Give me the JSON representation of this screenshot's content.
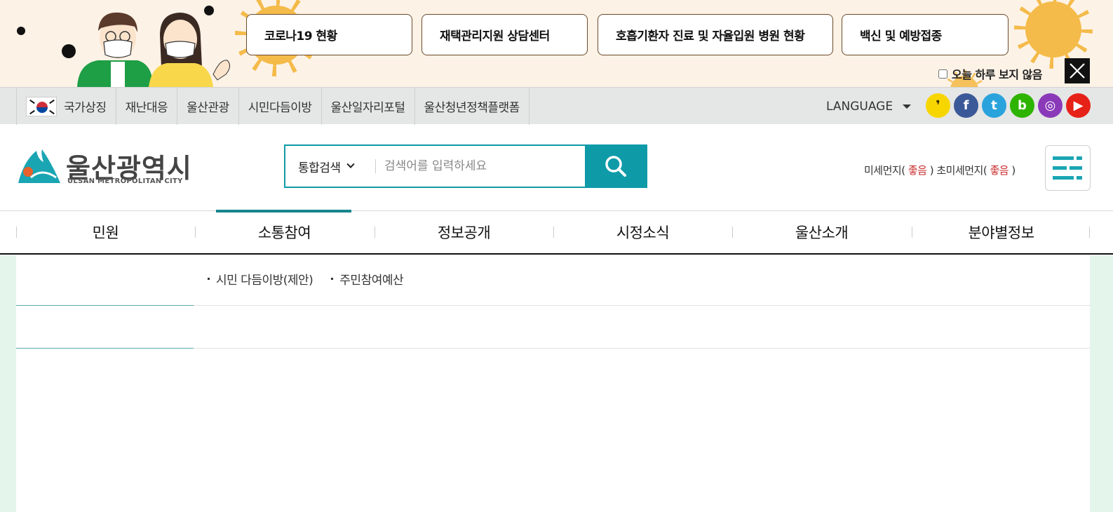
{
  "banner": {
    "buttons": [
      "코로나19 현황",
      "재택관리지원 상담센터",
      "호흡기환자 진료 및 자율입원 병원 현황",
      "백신 및 예방접종"
    ],
    "no_more_today": "오늘 하루 보지 않음",
    "close_icon": "close-icon"
  },
  "utilbar": {
    "links": [
      "국가상징",
      "재난대응",
      "울산관광",
      "시민다듬이방",
      "울산일자리포털",
      "울산청년정책플랫폼"
    ],
    "language": "LANGUAGE",
    "sns": [
      {
        "name": "kakaostory-icon",
        "glyph": "❜",
        "color": "#f7d600"
      },
      {
        "name": "facebook-icon",
        "glyph": "f",
        "color": "#3b5998"
      },
      {
        "name": "twitter-icon",
        "glyph": "t",
        "color": "#2aa3dc"
      },
      {
        "name": "blog-icon",
        "glyph": "b",
        "color": "#2db400"
      },
      {
        "name": "instagram-icon",
        "glyph": "◎",
        "color": "#8a3ab9"
      },
      {
        "name": "youtube-icon",
        "glyph": "▶",
        "color": "#e62117"
      }
    ]
  },
  "header": {
    "logo_text": "울산광역시",
    "logo_sub": "ULSAN METROPOLITAN CITY",
    "search_scope": "통합검색",
    "search_placeholder": "검색어를 입력하세요",
    "dust_label1": "미세먼지(",
    "dust_value1": "좋음",
    "dust_label2": ") 초미세먼지(",
    "dust_value2": "좋음",
    "dust_end": ")"
  },
  "gnb": {
    "items": [
      "민원",
      "소통참여",
      "정보공개",
      "시정소식",
      "울산소개",
      "분야별정보"
    ],
    "active_index": 1
  },
  "submenu": {
    "links": [
      "시민 다듬이방(제안)",
      "주민참여예산"
    ]
  },
  "colors": {
    "accent": "#0f9aa8",
    "active_bar": "#17858f",
    "good": "#c8282a",
    "side_bg": "#e4f6ec"
  }
}
